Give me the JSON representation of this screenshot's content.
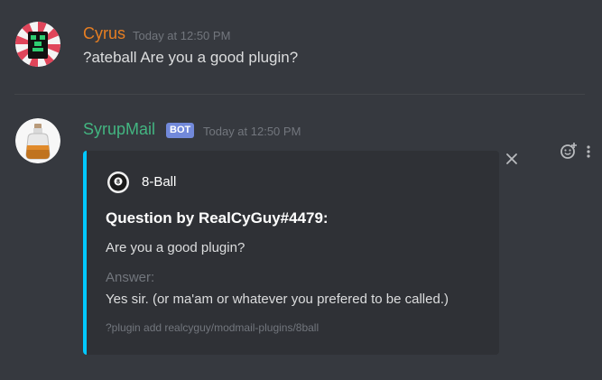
{
  "colors": {
    "background": "#36393f",
    "embed_background": "#2f3136",
    "embed_accent": "#00c8ff",
    "user1_color": "#e67e22",
    "user2_color": "#43b581",
    "bot_badge": "#7289da",
    "timestamp": "#72767d"
  },
  "messages": [
    {
      "username": "Cyrus",
      "timestamp": "Today at 12:50 PM",
      "content": "?ateball Are you a good plugin?"
    },
    {
      "username": "SyrupMail",
      "badge": "BOT",
      "timestamp": "Today at 12:50 PM",
      "embed": {
        "author": "8-Ball",
        "author_icon": "eight-ball-icon",
        "title": "Question by RealCyGuy#4479:",
        "description": "Are you a good plugin?",
        "field_name": "Answer:",
        "field_value": "Yes sir. (or ma'am or whatever you prefered to be called.)",
        "footer": "?plugin add realcyguy/modmail-plugins/8ball"
      }
    }
  ],
  "actions": {
    "close_icon": "close-icon",
    "reaction_icon": "add-reaction-icon",
    "more_icon": "more-options-icon"
  }
}
